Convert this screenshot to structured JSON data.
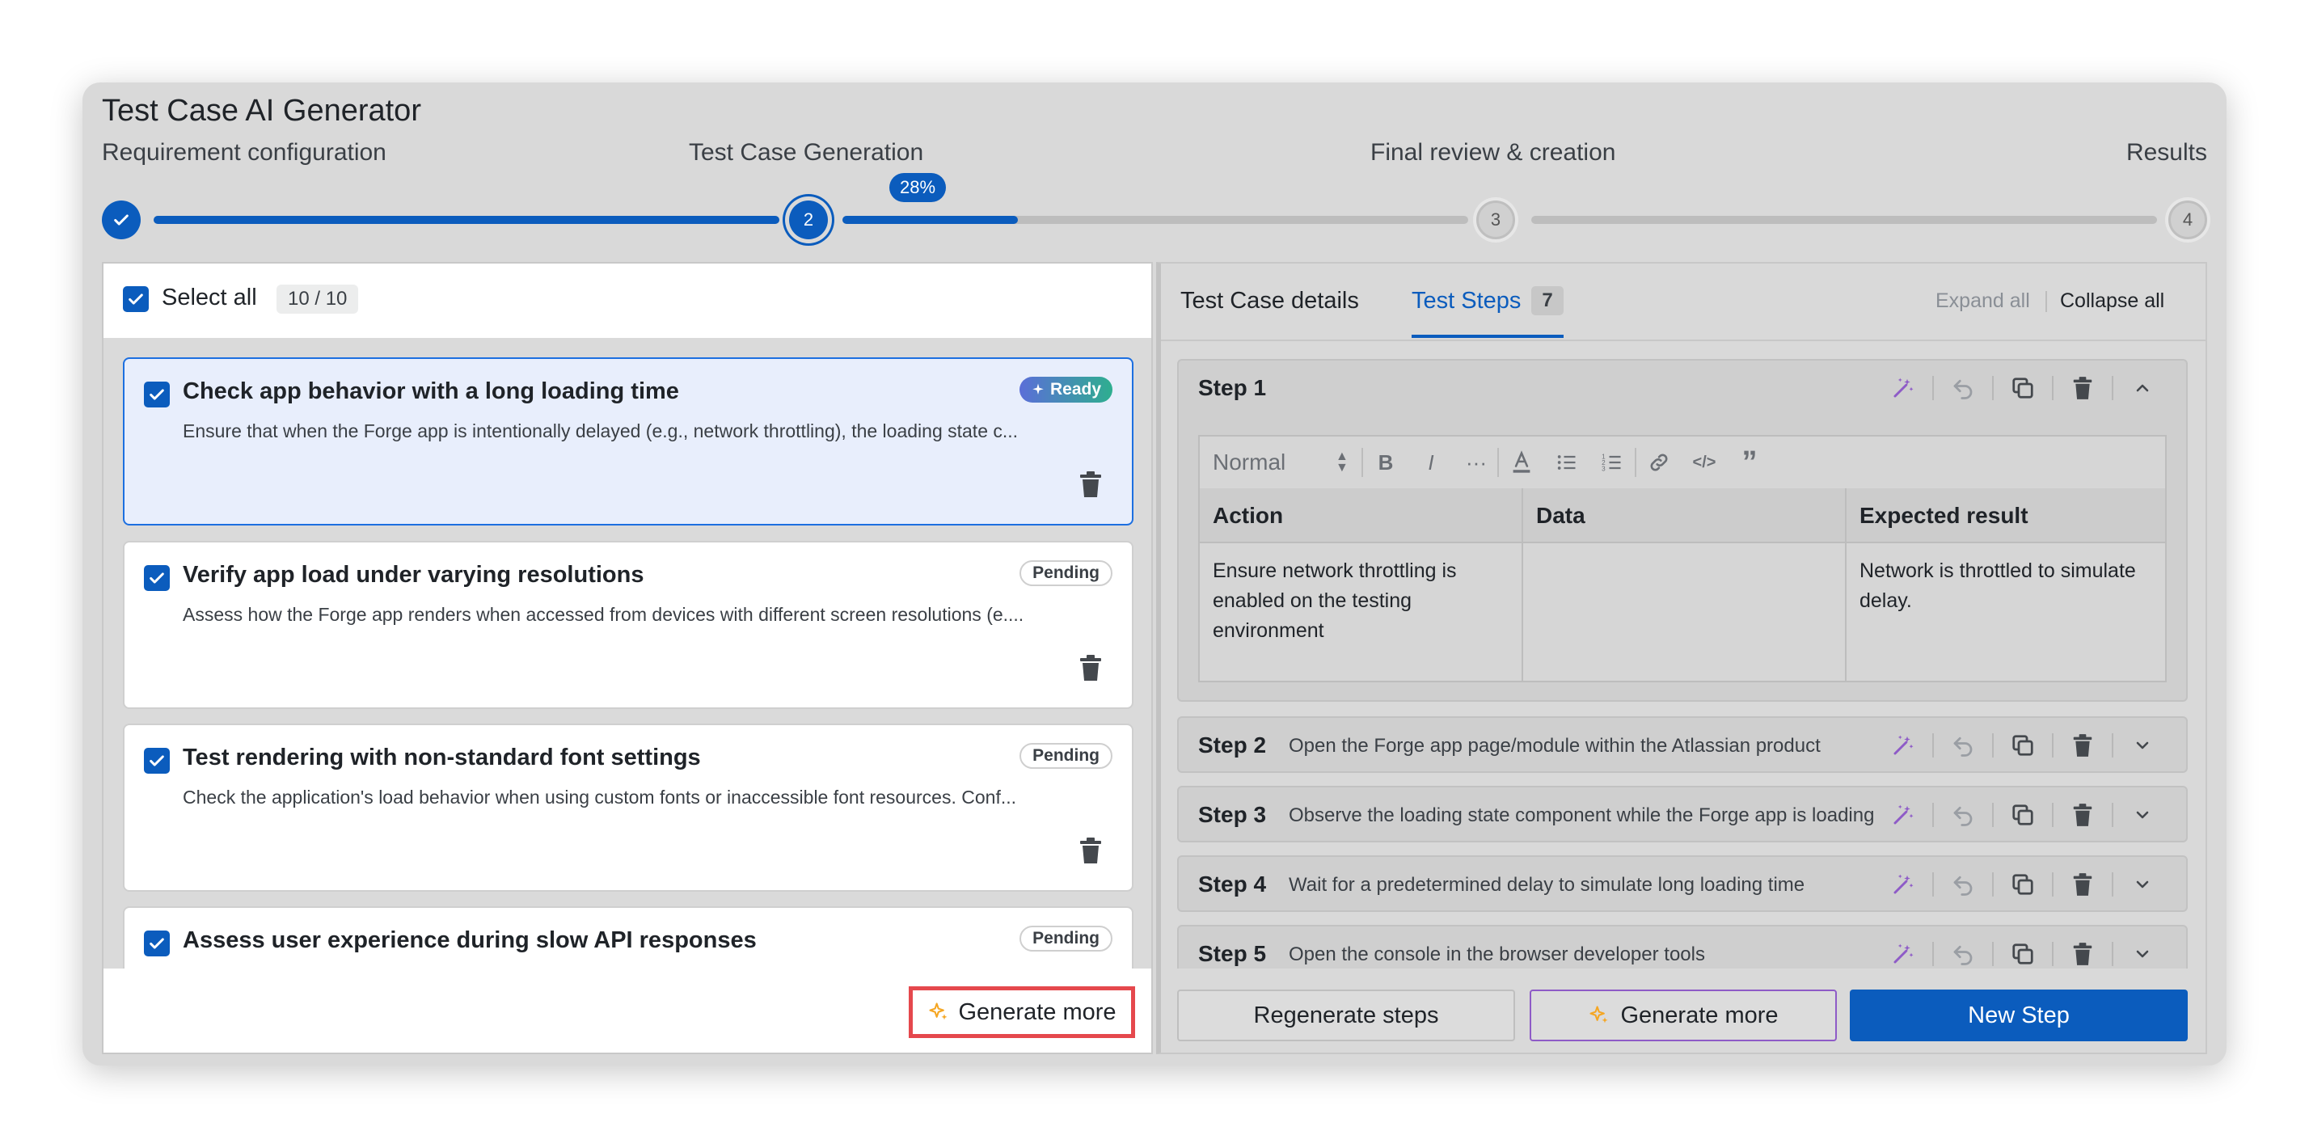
{
  "app": {
    "title": "Test Case AI Generator"
  },
  "stepper": {
    "stages": [
      "Requirement configuration",
      "Test Case Generation",
      "Final review & creation",
      "Results"
    ],
    "current_step": "2",
    "step3": "3",
    "step4": "4",
    "progress_label": "28%",
    "progress_value": 0.28,
    "done_icon": "check-icon"
  },
  "left": {
    "select_all_label": "Select all",
    "selected_count": "10 / 10",
    "cards": [
      {
        "title": "Check app behavior with a long loading time",
        "description": "Ensure that when the Forge app is intentionally delayed (e.g., network throttling), the loading state c...",
        "status": "Ready"
      },
      {
        "title": "Verify app load under varying resolutions",
        "description": "Assess how the Forge app renders when accessed from devices with different screen resolutions (e....",
        "status": "Pending"
      },
      {
        "title": "Test rendering with non-standard font settings",
        "description": "Check the application's load behavior when using custom fonts or inaccessible font resources. Conf...",
        "status": "Pending"
      },
      {
        "title": "Assess user experience during slow API responses",
        "description": "",
        "status": "Pending"
      }
    ],
    "generate_more_label": "Generate more"
  },
  "right": {
    "tabs": {
      "details": "Test Case details",
      "steps": "Test Steps",
      "steps_count": "7"
    },
    "expand_all": "Expand all",
    "collapse_all": "Collapse all",
    "step1": {
      "name": "Step 1",
      "toolbar_style": "Normal",
      "headers": [
        "Action",
        "Data",
        "Expected result"
      ],
      "action": "Ensure network throttling is enabled on the testing environment",
      "data": "",
      "expected": "Network is throttled to simulate delay."
    },
    "steps": [
      {
        "name": "Step 2",
        "summary": "Open the Forge app page/module within the Atlassian product"
      },
      {
        "name": "Step 3",
        "summary": "Observe the loading state component while the Forge app is loading"
      },
      {
        "name": "Step 4",
        "summary": "Wait for a predetermined delay to simulate long loading time"
      },
      {
        "name": "Step 5",
        "summary": "Open the console in the browser developer tools"
      }
    ],
    "footer": {
      "regenerate": "Regenerate steps",
      "generate_more": "Generate more",
      "new_step": "New Step"
    }
  },
  "colors": {
    "accent": "#0b5cbd",
    "highlight_border": "#e5484d",
    "ai_purple": "#8e5bc7",
    "sparkle_orange": "#f5a623"
  }
}
